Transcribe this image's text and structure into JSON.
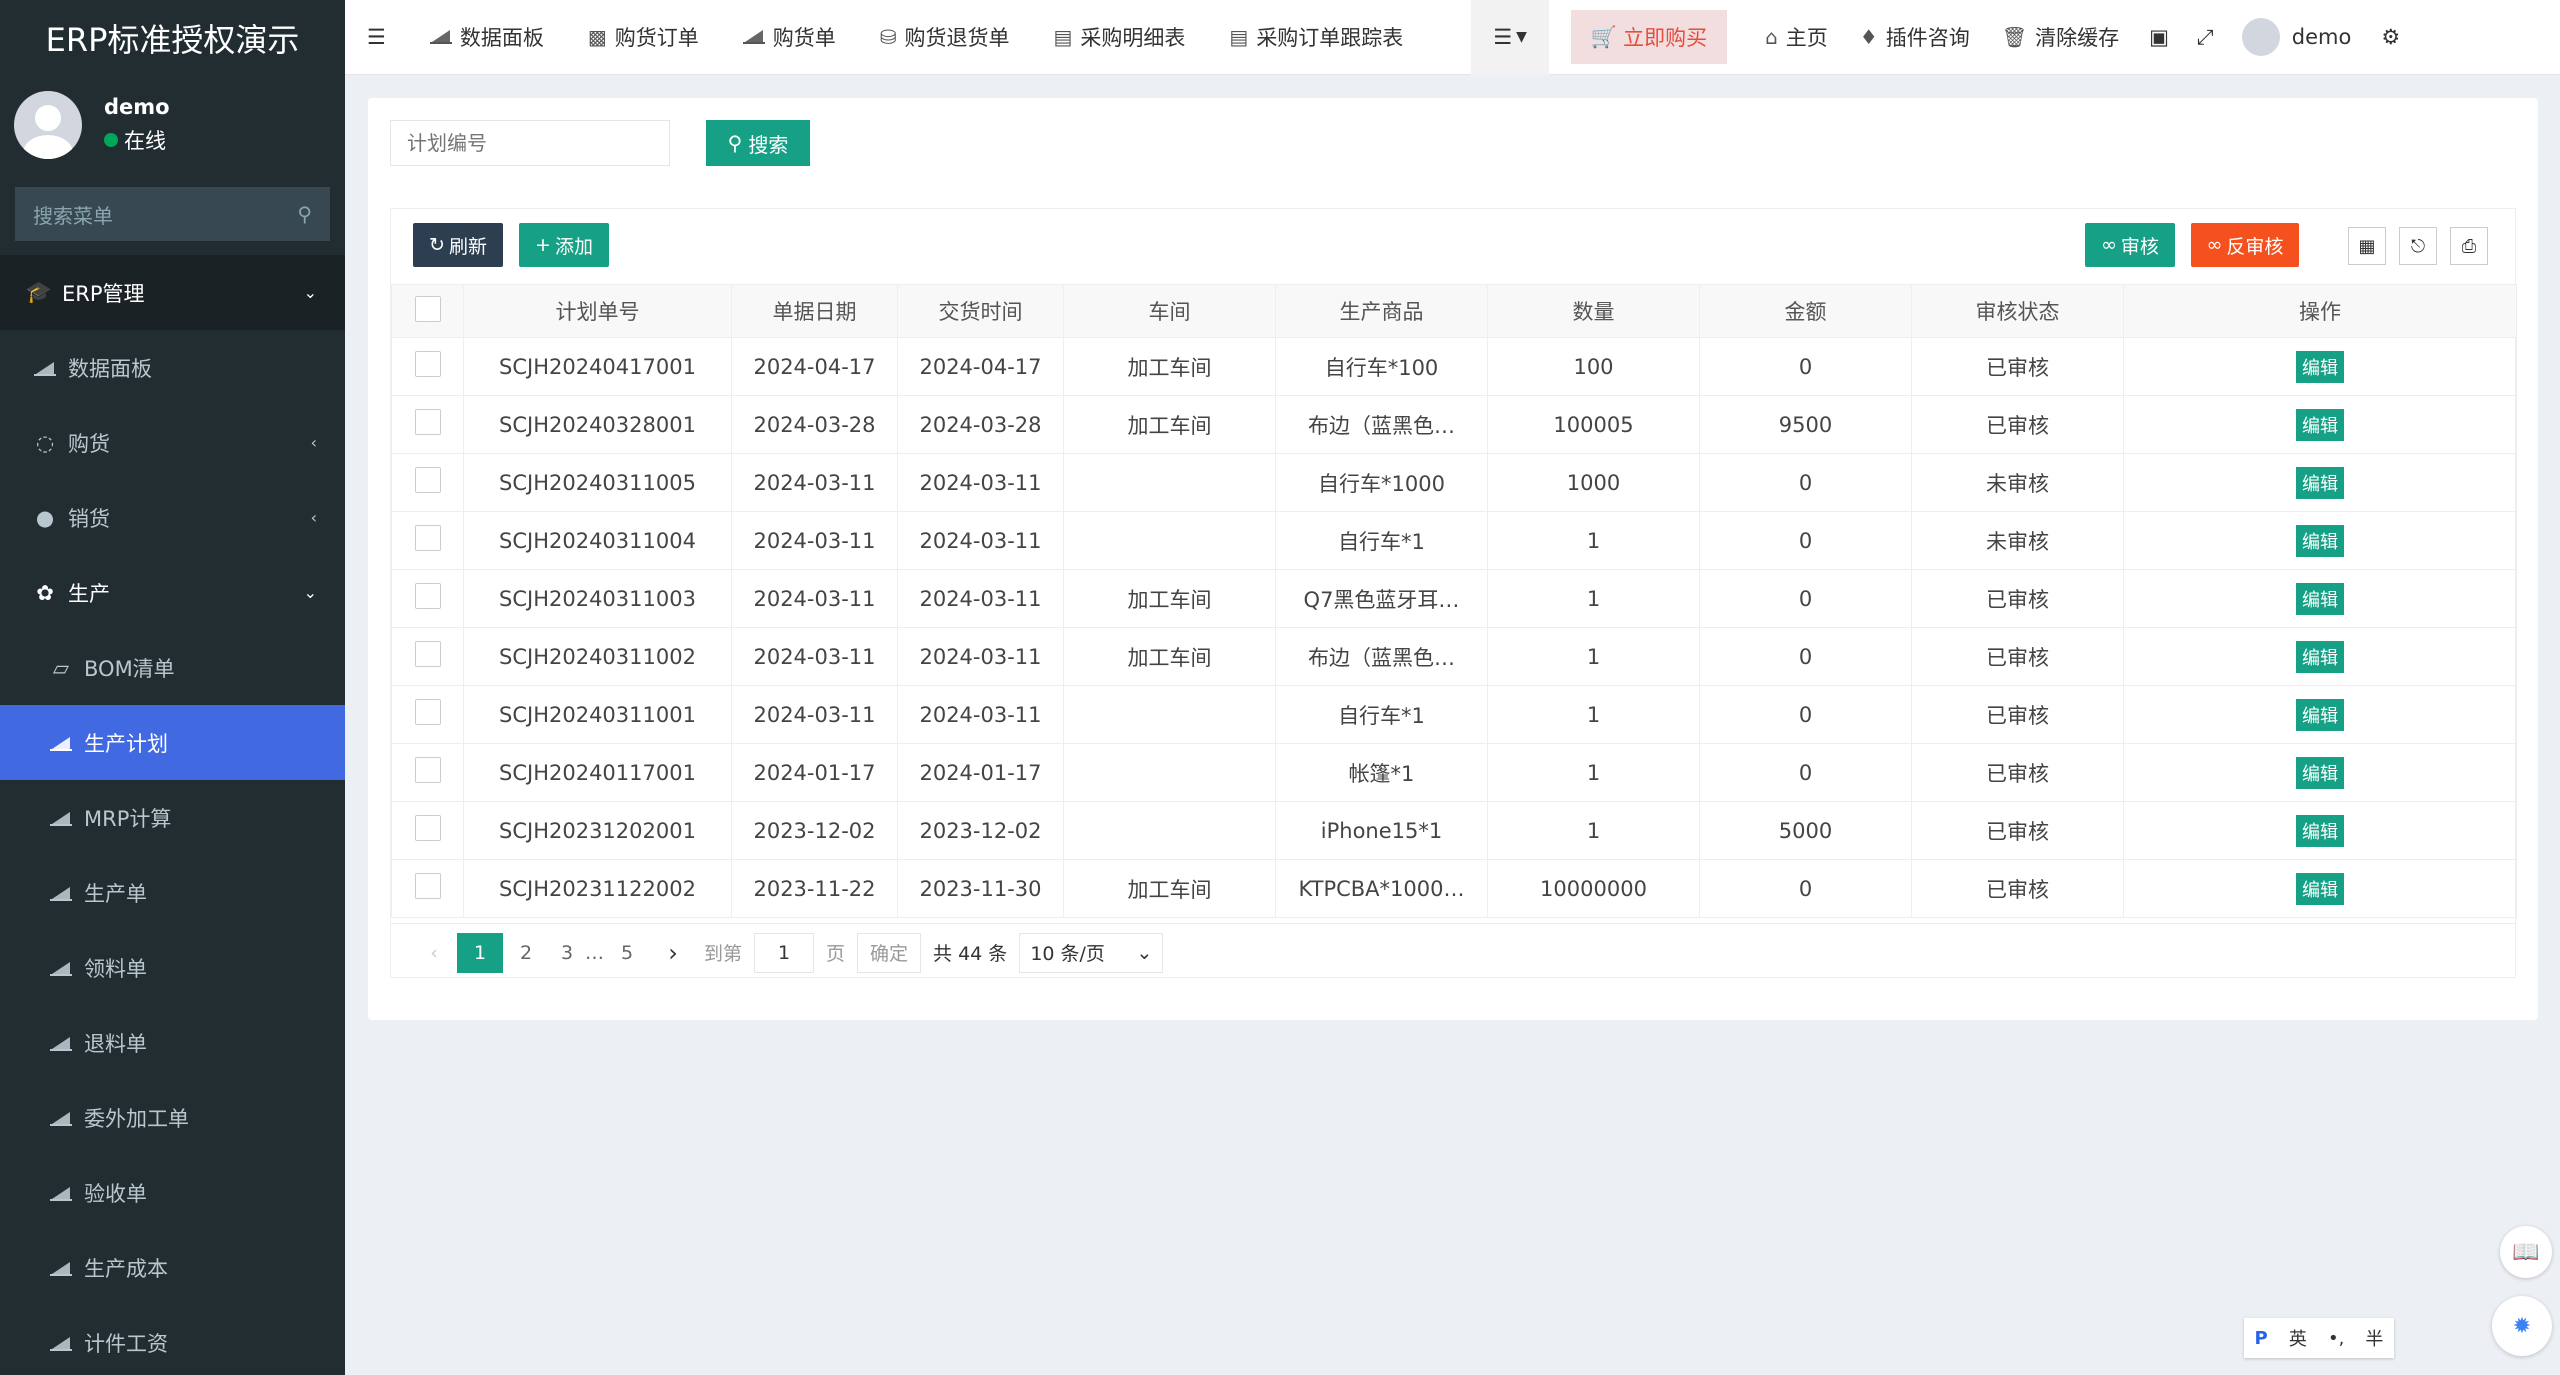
{
  "sidebar": {
    "brand": "ERP标准授权演示",
    "user": {
      "name": "demo",
      "status": "在线"
    },
    "search_placeholder": "搜索菜单",
    "items": [
      {
        "label": "ERP管理"
      },
      {
        "label": "数据面板"
      },
      {
        "label": "购货"
      },
      {
        "label": "销货"
      },
      {
        "label": "生产"
      },
      {
        "label": "BOM清单"
      },
      {
        "label": "生产计划"
      },
      {
        "label": "MRP计算"
      },
      {
        "label": "生产单"
      },
      {
        "label": "领料单"
      },
      {
        "label": "退料单"
      },
      {
        "label": "委外加工单"
      },
      {
        "label": "验收单"
      },
      {
        "label": "生产成本"
      },
      {
        "label": "计件工资"
      }
    ]
  },
  "navbar": {
    "tabs": [
      "数据面板",
      "购货订单",
      "购货单",
      "购货退货单",
      "采购明细表",
      "采购订单跟踪表"
    ],
    "buy_now": "立即购买",
    "home": "主页",
    "plugin": "插件咨询",
    "clear_cache": "清除缓存",
    "user": "demo"
  },
  "search": {
    "placeholder": "计划编号",
    "button": "搜索"
  },
  "toolbar": {
    "refresh": "刷新",
    "add": "添加",
    "audit": "审核",
    "unaudit": "反审核"
  },
  "table": {
    "headers": [
      "计划单号",
      "单据日期",
      "交货时间",
      "车间",
      "生产商品",
      "数量",
      "金额",
      "审核状态",
      "操作"
    ],
    "rows": [
      [
        "SCJH20240417001",
        "2024-04-17",
        "2024-04-17",
        "加工车间",
        "自行车*100",
        "100",
        "0",
        "已审核"
      ],
      [
        "SCJH20240328001",
        "2024-03-28",
        "2024-03-28",
        "加工车间",
        "布边（蓝黑色…",
        "100005",
        "9500",
        "已审核"
      ],
      [
        "SCJH20240311005",
        "2024-03-11",
        "2024-03-11",
        "",
        "自行车*1000",
        "1000",
        "0",
        "未审核"
      ],
      [
        "SCJH20240311004",
        "2024-03-11",
        "2024-03-11",
        "",
        "自行车*1",
        "1",
        "0",
        "未审核"
      ],
      [
        "SCJH20240311003",
        "2024-03-11",
        "2024-03-11",
        "加工车间",
        "Q7黑色蓝牙耳…",
        "1",
        "0",
        "已审核"
      ],
      [
        "SCJH20240311002",
        "2024-03-11",
        "2024-03-11",
        "加工车间",
        "布边（蓝黑色…",
        "1",
        "0",
        "已审核"
      ],
      [
        "SCJH20240311001",
        "2024-03-11",
        "2024-03-11",
        "",
        "自行车*1",
        "1",
        "0",
        "已审核"
      ],
      [
        "SCJH20240117001",
        "2024-01-17",
        "2024-01-17",
        "",
        "帐篷*1",
        "1",
        "0",
        "已审核"
      ],
      [
        "SCJH20231202001",
        "2023-12-02",
        "2023-12-02",
        "",
        "iPhone15*1",
        "1",
        "5000",
        "已审核"
      ],
      [
        "SCJH20231122002",
        "2023-11-22",
        "2023-11-30",
        "加工车间",
        "KTPCBA*1000…",
        "10000000",
        "0",
        "已审核"
      ]
    ],
    "edit_label": "编辑"
  },
  "pager": {
    "pages": [
      "1",
      "2",
      "3",
      "…",
      "5"
    ],
    "goto": "到第",
    "page_value": "1",
    "page_unit": "页",
    "confirm": "确定",
    "total": "共 44 条",
    "page_size": "10 条/页"
  },
  "ime": {
    "mode": "英",
    "punct": "•,",
    "width": "半"
  }
}
